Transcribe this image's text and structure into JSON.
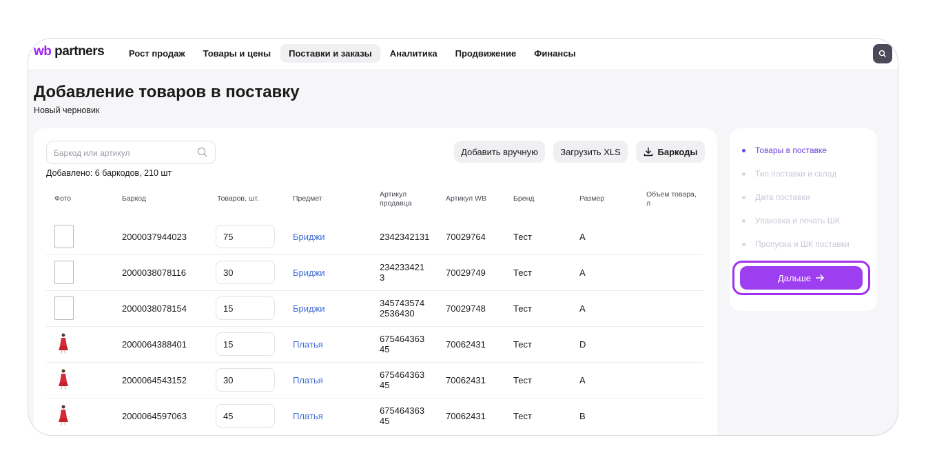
{
  "brand": {
    "wb": "wb",
    "partners": "partners"
  },
  "nav": [
    "Рост продаж",
    "Товары и цены",
    "Поставки и заказы",
    "Аналитика",
    "Продвижение",
    "Финансы"
  ],
  "page": {
    "title": "Добавление товаров в поставку",
    "subtitle": "Новый черновик"
  },
  "toolbar": {
    "search_placeholder": "Баркод или артикул",
    "add_manual": "Добавить вручную",
    "upload_xls": "Загрузить XLS",
    "barcodes": "Баркоды"
  },
  "summary": "Добавлено: 6 баркодов, 210 шт",
  "table": {
    "headers": [
      "Фото",
      "Баркод",
      "Товаров, шт.",
      "Предмет",
      "Артикул продавца",
      "Артикул WB",
      "Бренд",
      "Размер",
      "Объем товара, л"
    ],
    "rows": [
      {
        "photo": "placeholder",
        "barcode": "2000037944023",
        "qty": "75",
        "subject": "Бриджи",
        "seller_art": "2342342131",
        "wb_art": "70029764",
        "brand": "Тест",
        "size": "A"
      },
      {
        "photo": "placeholder",
        "barcode": "2000038078116",
        "qty": "30",
        "subject": "Бриджи",
        "seller_art": "234233421\n3",
        "wb_art": "70029749",
        "brand": "Тест",
        "size": "A"
      },
      {
        "photo": "placeholder",
        "barcode": "2000038078154",
        "qty": "15",
        "subject": "Бриджи",
        "seller_art": "345743574\n2536430",
        "wb_art": "70029748",
        "brand": "Тест",
        "size": "A"
      },
      {
        "photo": "dress",
        "barcode": "2000064388401",
        "qty": "15",
        "subject": "Платья",
        "seller_art": "675464363\n45",
        "wb_art": "70062431",
        "brand": "Тест",
        "size": "D"
      },
      {
        "photo": "dress",
        "barcode": "2000064543152",
        "qty": "30",
        "subject": "Платья",
        "seller_art": "675464363\n45",
        "wb_art": "70062431",
        "brand": "Тест",
        "size": "A"
      },
      {
        "photo": "dress",
        "barcode": "2000064597063",
        "qty": "45",
        "subject": "Платья",
        "seller_art": "675464363\n45",
        "wb_art": "70062431",
        "brand": "Тест",
        "size": "B"
      }
    ]
  },
  "steps": [
    {
      "label": "Товары в поставке",
      "active": true
    },
    {
      "label": "Тип поставки и склад",
      "active": false
    },
    {
      "label": "Дата поставки",
      "active": false
    },
    {
      "label": "Упаковка и печать ШК",
      "active": false
    },
    {
      "label": "Пропуска и ШК поставки",
      "active": false
    }
  ],
  "next_button": "Дальше",
  "colors": {
    "accent": "#9d3ef0",
    "link": "#3f6bd6",
    "step_active": "#6a3fe0"
  }
}
